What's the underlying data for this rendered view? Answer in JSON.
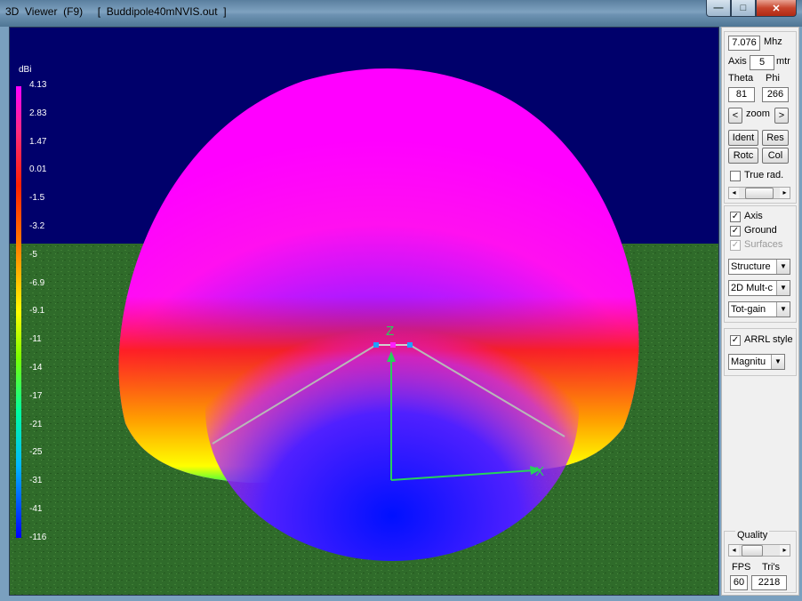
{
  "window": {
    "title": "3D  Viewer  (F9)     [  Buddipole40mNVIS.out  ]",
    "min_glyph": "—",
    "max_glyph": "□",
    "close_glyph": "✕"
  },
  "legend": {
    "unit": "dBi",
    "ticks": [
      "4.13",
      "2.83",
      "1.47",
      "0.01",
      "-1.5",
      "-3.2",
      "-5",
      "-6.9",
      "-9.1",
      "-11",
      "-14",
      "-17",
      "-21",
      "-25",
      "-31",
      "-41",
      "-116"
    ],
    "colors": [
      "#ff00ff",
      "#ff2a80",
      "#ff2000",
      "#ff7a00",
      "#ffff00",
      "#7cff00",
      "#00ffa0",
      "#00b8ff",
      "#0000ff"
    ]
  },
  "scene": {
    "axis_z_label": "Z",
    "axis_x_label": "X",
    "sky_color": "#00006b",
    "ground_color": "#2f6b2a",
    "axis_color": "#28d05a",
    "wire_color": "#b0b0b0"
  },
  "controls": {
    "frequency": "7.076",
    "frequency_unit": "Mhz",
    "axis_label": "Axis",
    "axis_value": "5",
    "axis_unit": "mtr",
    "theta_label": "Theta",
    "phi_label": "Phi",
    "theta_value": "81",
    "phi_value": "266",
    "zoom_label": "zoom",
    "zoom_left": "<",
    "zoom_right": ">",
    "buttons": [
      "Ident",
      "Res",
      "Rotc",
      "Col"
    ],
    "true_rad_label": "True rad.",
    "true_rad_checked": false,
    "axis_check_label": "Axis",
    "axis_checked": true,
    "ground_check_label": "Ground",
    "ground_checked": true,
    "surfaces_check_label": "Surfaces",
    "surfaces_checked": true,
    "surfaces_disabled": true,
    "dropdowns": [
      "Structure",
      "2D Mult-c",
      "Tot-gain"
    ],
    "arrl_label": "ARRL style",
    "arrl_checked": true,
    "arrl_dropdown": "Magnitu",
    "quality_label": "Quality",
    "fps_label": "FPS",
    "tris_label": "Tri's",
    "fps_value": "60",
    "tris_value": "2218",
    "check_glyph": "✓",
    "dropdown_glyph": "▼",
    "slider_left": "◂",
    "slider_right": "▸"
  }
}
